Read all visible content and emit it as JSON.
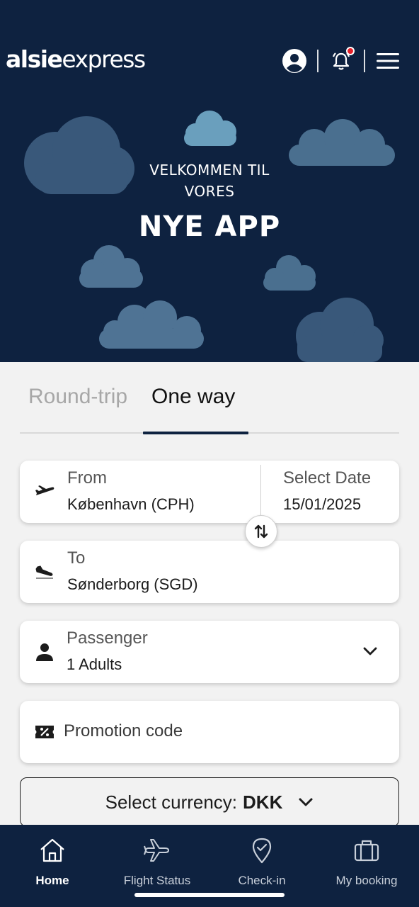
{
  "header": {
    "logo_bold": "alsie",
    "logo_light": "express",
    "icons": [
      "account-icon",
      "notification-bell-icon",
      "menu-icon"
    ],
    "notification_dot_color": "#e8202a"
  },
  "hero": {
    "line1": "VELKOMMEN TIL",
    "line2": "VORES",
    "line3": "NYE APP",
    "background": "#0e2240"
  },
  "tabs": [
    {
      "label": "Round-trip",
      "selected": false
    },
    {
      "label": "One way",
      "selected": true
    }
  ],
  "form": {
    "from": {
      "label": "From",
      "value": "København (CPH)",
      "icon": "plane-departure-icon"
    },
    "date": {
      "label": "Select Date",
      "value": "15/01/2025"
    },
    "swap_icon": "swap-arrows-icon",
    "to": {
      "label": "To",
      "value": "Sønderborg (SGD)",
      "icon": "plane-arrival-icon"
    },
    "passenger": {
      "label": "Passenger",
      "value": "1 Adults",
      "icon": "person-icon"
    },
    "promo": {
      "placeholder": "Promotion code",
      "icon": "ticket-percent-icon"
    },
    "currency": {
      "label": "Select currency:",
      "value": "DKK"
    }
  },
  "bottom_nav": [
    {
      "label": "Home",
      "icon": "home-icon",
      "active": true
    },
    {
      "label": "Flight Status",
      "icon": "airplane-icon",
      "active": false
    },
    {
      "label": "Check-in",
      "icon": "location-check-icon",
      "active": false
    },
    {
      "label": "My booking",
      "icon": "briefcase-icon",
      "active": false
    }
  ]
}
